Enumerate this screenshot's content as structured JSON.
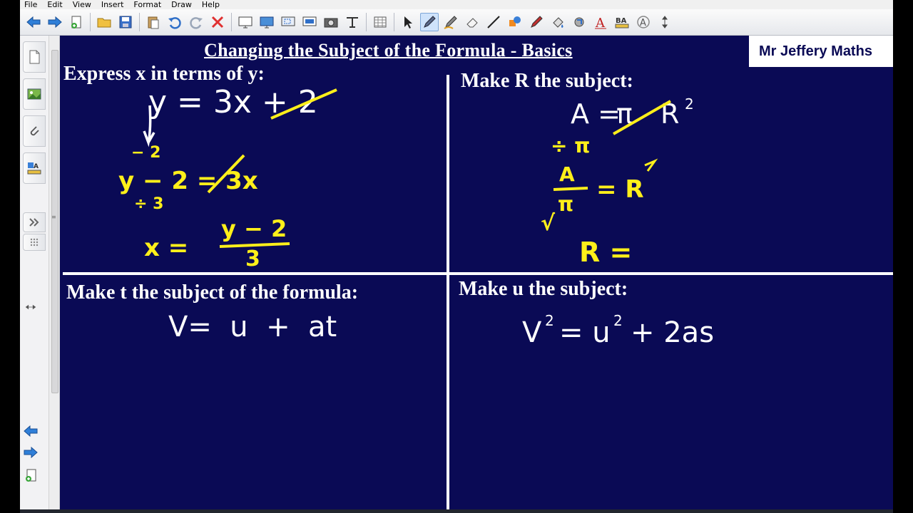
{
  "menu": [
    "File",
    "Edit",
    "View",
    "Insert",
    "Format",
    "Draw",
    "Help"
  ],
  "toolbar_icons": [
    "back-arrow-icon",
    "forward-arrow-icon",
    "new-page-icon",
    "open-folder-icon",
    "save-icon",
    "paste-icon",
    "undo-icon",
    "redo-icon",
    "delete-icon",
    "screen-shade-icon",
    "show-display-icon",
    "screen-capture-icon",
    "screen-capture-window-icon",
    "camera-icon",
    "recorder-icon",
    "table-icon",
    "select-arrow-icon",
    "pen-icon",
    "creative-pen-icon",
    "eraser-icon",
    "line-icon",
    "shapes-icon",
    "magic-pen-icon",
    "fill-icon",
    "text-icon",
    "properties-icon",
    "move-toolbar-icon"
  ],
  "slide": {
    "title": "Changing the Subject of the Formula - Basics",
    "brand": "Mr Jeffery Maths",
    "q1": {
      "prompt": "Express x in terms of y:",
      "equation": "y = 3x + 2",
      "step1_op": "− 2",
      "step1": "y − 2 = 3x",
      "step2_op": "÷ 3",
      "answer_lhs": "x =",
      "answer_num": "y − 2",
      "answer_den": "3"
    },
    "q2": {
      "prompt": "Make R the subject:",
      "equation_lhs": "A =",
      "equation_pi": "π",
      "equation_r": "R",
      "exp": "2",
      "op1": "÷ π",
      "frac_num": "A",
      "frac_den": "π",
      "eq_r": "= R",
      "op2": "√",
      "answer": "R ="
    },
    "q3": {
      "prompt": "Make t the subject of the formula:",
      "equation": "V=  u  +  at"
    },
    "q4": {
      "prompt": "Make u the subject:",
      "v": "V",
      "mid": "= u",
      "rest": "+ 2as",
      "exp": "2"
    }
  }
}
